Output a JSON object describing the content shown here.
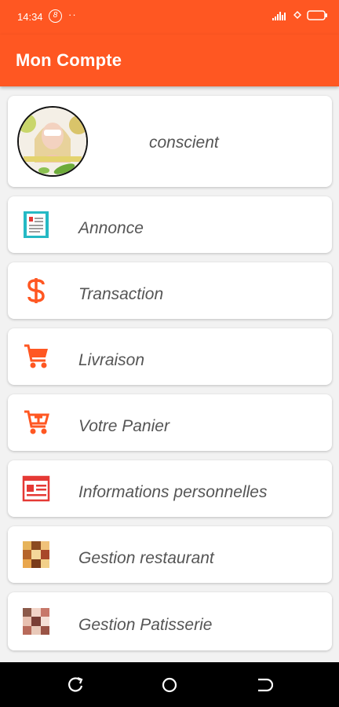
{
  "status_bar": {
    "time": "14:34",
    "badge": "8",
    "dots": "··"
  },
  "app_bar": {
    "title": "Mon Compte"
  },
  "profile": {
    "name": "conscient",
    "avatar_caption": "Sogibe Beauté Naturel"
  },
  "menu": [
    {
      "label": "Annonce",
      "icon": "document-icon"
    },
    {
      "label": "Transaction",
      "icon": "dollar-icon"
    },
    {
      "label": "Livraison",
      "icon": "cart-icon"
    },
    {
      "label": "Votre Panier",
      "icon": "cart-add-icon"
    },
    {
      "label": "Informations personnelles",
      "icon": "id-card-icon"
    },
    {
      "label": "Gestion restaurant",
      "icon": "food-photo-icon"
    },
    {
      "label": "Gestion Patisserie",
      "icon": "pastry-photo-icon"
    }
  ],
  "colors": {
    "primary": "#ff5722",
    "icon_teal": "#25b9c4",
    "icon_red": "#e53935"
  }
}
